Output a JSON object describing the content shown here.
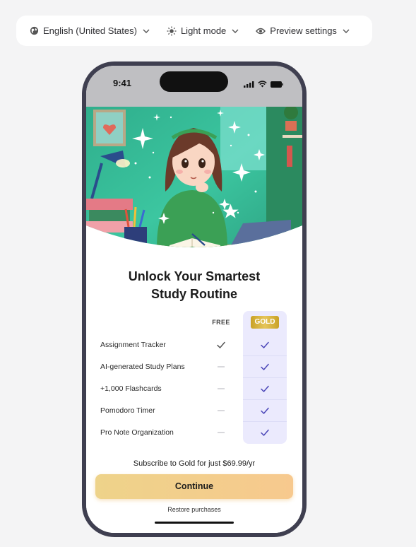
{
  "toolbar": {
    "language": {
      "label": "English (United States)",
      "icon": "globe-icon"
    },
    "mode": {
      "label": "Light mode",
      "icon": "sun-icon"
    },
    "preview": {
      "label": "Preview settings",
      "icon": "eye-icon"
    }
  },
  "status_bar": {
    "time": "9:41"
  },
  "paywall": {
    "title_line1": "Unlock Your Smartest",
    "title_line2": "Study Routine",
    "columns": {
      "free": "FREE",
      "gold": "GOLD"
    },
    "features": [
      {
        "label": "Assignment Tracker",
        "free": true,
        "gold": true
      },
      {
        "label": "AI-generated Study Plans",
        "free": false,
        "gold": true
      },
      {
        "label": "+1,000 Flashcards",
        "free": false,
        "gold": true
      },
      {
        "label": "Pomodoro Timer",
        "free": false,
        "gold": true
      },
      {
        "label": "Pro Note Organization",
        "free": false,
        "gold": true
      }
    ],
    "subscribe_text": "Subscribe to Gold for just $69.99/yr",
    "continue_label": "Continue",
    "restore_label": "Restore purchases"
  },
  "colors": {
    "accent_check": "#4b47b8",
    "gold_column": "#ebeafd",
    "button_gradient_start": "#eed38a",
    "button_gradient_end": "#f7c98e",
    "phone_frame": "#3f3f50"
  }
}
